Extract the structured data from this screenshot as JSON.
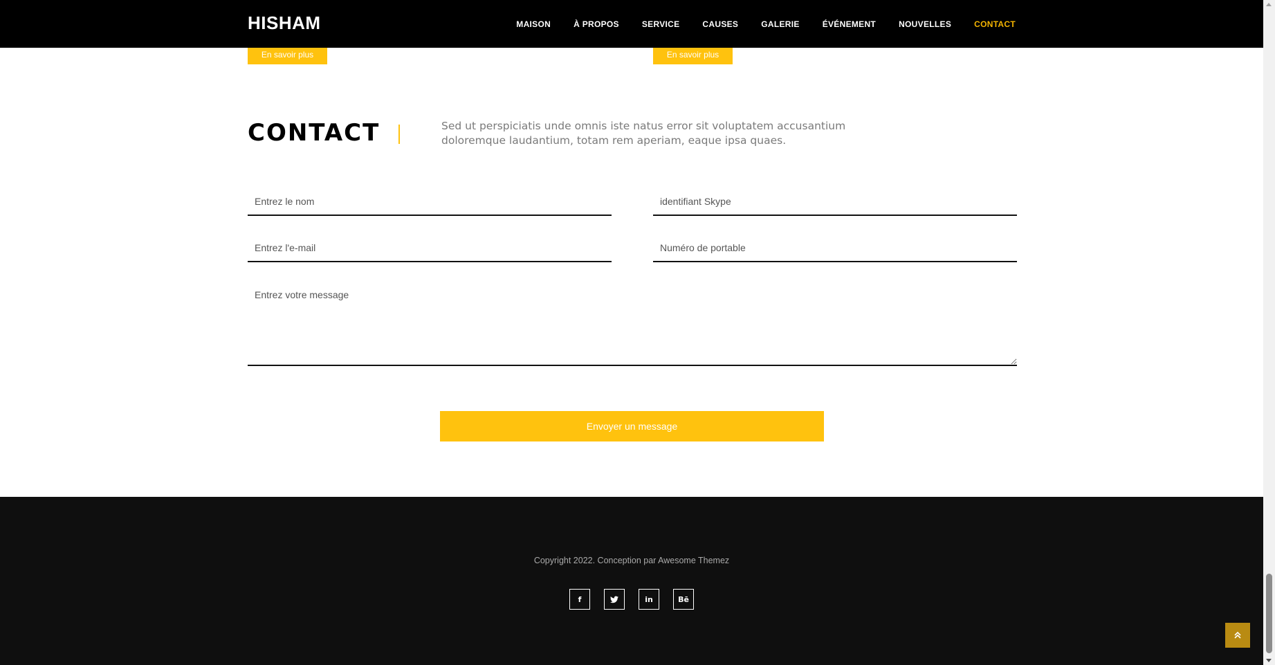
{
  "brand": "HISHAM",
  "nav": {
    "items": [
      {
        "label": "MAISON",
        "active": false
      },
      {
        "label": "À PROPOS",
        "active": false
      },
      {
        "label": "SERVICE",
        "active": false
      },
      {
        "label": "CAUSES",
        "active": false
      },
      {
        "label": "GALERIE",
        "active": false
      },
      {
        "label": "ÉVÉNEMENT",
        "active": false
      },
      {
        "label": "NOUVELLES",
        "active": false
      },
      {
        "label": "CONTACT",
        "active": true
      }
    ]
  },
  "learn_more": {
    "left_label": "En savoir plus",
    "right_label": "En savoir plus"
  },
  "contact": {
    "title": "CONTACT",
    "description": "Sed ut perspiciatis unde omnis iste natus error sit voluptatem accusantium doloremque laudantium, totam rem aperiam, eaque ipsa quaes."
  },
  "form": {
    "name_placeholder": "Entrez le nom",
    "skype_placeholder": "identifiant Skype",
    "email_placeholder": "Entrez l'e-mail",
    "mobile_placeholder": "Numéro de portable",
    "message_placeholder": "Entrez votre message",
    "submit_label": "Envoyer un message"
  },
  "footer": {
    "copyright": "Copyright 2022. Conception par Awesome Themez",
    "socials": [
      {
        "icon": "facebook-icon",
        "glyph": "f"
      },
      {
        "icon": "twitter-icon",
        "glyph": "🐦"
      },
      {
        "icon": "linkedin-icon",
        "glyph": "in"
      },
      {
        "icon": "behance-icon",
        "glyph": "Bē"
      }
    ]
  },
  "colors": {
    "accent": "#ffc20e",
    "navbar": "#000000",
    "footer": "#0f0f0f",
    "to_top": "#b98b12"
  }
}
